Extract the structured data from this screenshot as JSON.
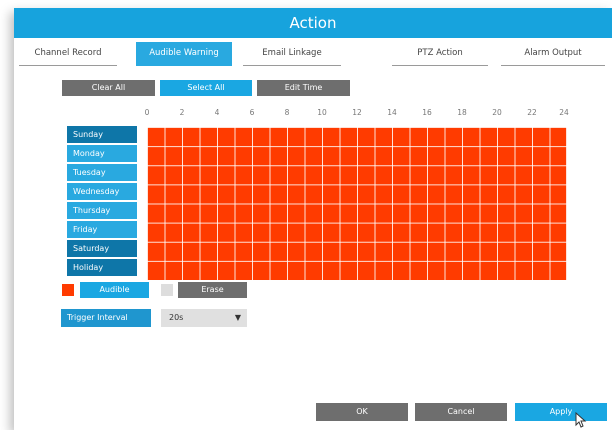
{
  "window": {
    "title": "Action"
  },
  "tabs": [
    {
      "label": "Channel Record",
      "active": false
    },
    {
      "label": "Audible Warning",
      "active": true
    },
    {
      "label": "Email Linkage",
      "active": false
    },
    {
      "label": "PTZ Action",
      "active": false
    },
    {
      "label": "Alarm Output",
      "active": false
    }
  ],
  "toolbar": {
    "clear_all": "Clear All",
    "select_all": "Select All",
    "edit_time": "Edit Time"
  },
  "hours": [
    "0",
    "2",
    "4",
    "6",
    "8",
    "10",
    "12",
    "14",
    "16",
    "18",
    "20",
    "22",
    "24"
  ],
  "days": [
    "Sunday",
    "Monday",
    "Tuesday",
    "Wednesday",
    "Thursday",
    "Friday",
    "Saturday",
    "Holiday"
  ],
  "schedule": {
    "fill_color": "#ff3b00",
    "all_selected": true
  },
  "legend": {
    "audible_label": "Audible",
    "audible_color": "#ff3b00",
    "erase_label": "Erase",
    "erase_color": "#dddddd"
  },
  "trigger_interval": {
    "label": "Trigger Interval",
    "value": "20s"
  },
  "footer": {
    "ok": "OK",
    "cancel": "Cancel",
    "apply": "Apply"
  }
}
